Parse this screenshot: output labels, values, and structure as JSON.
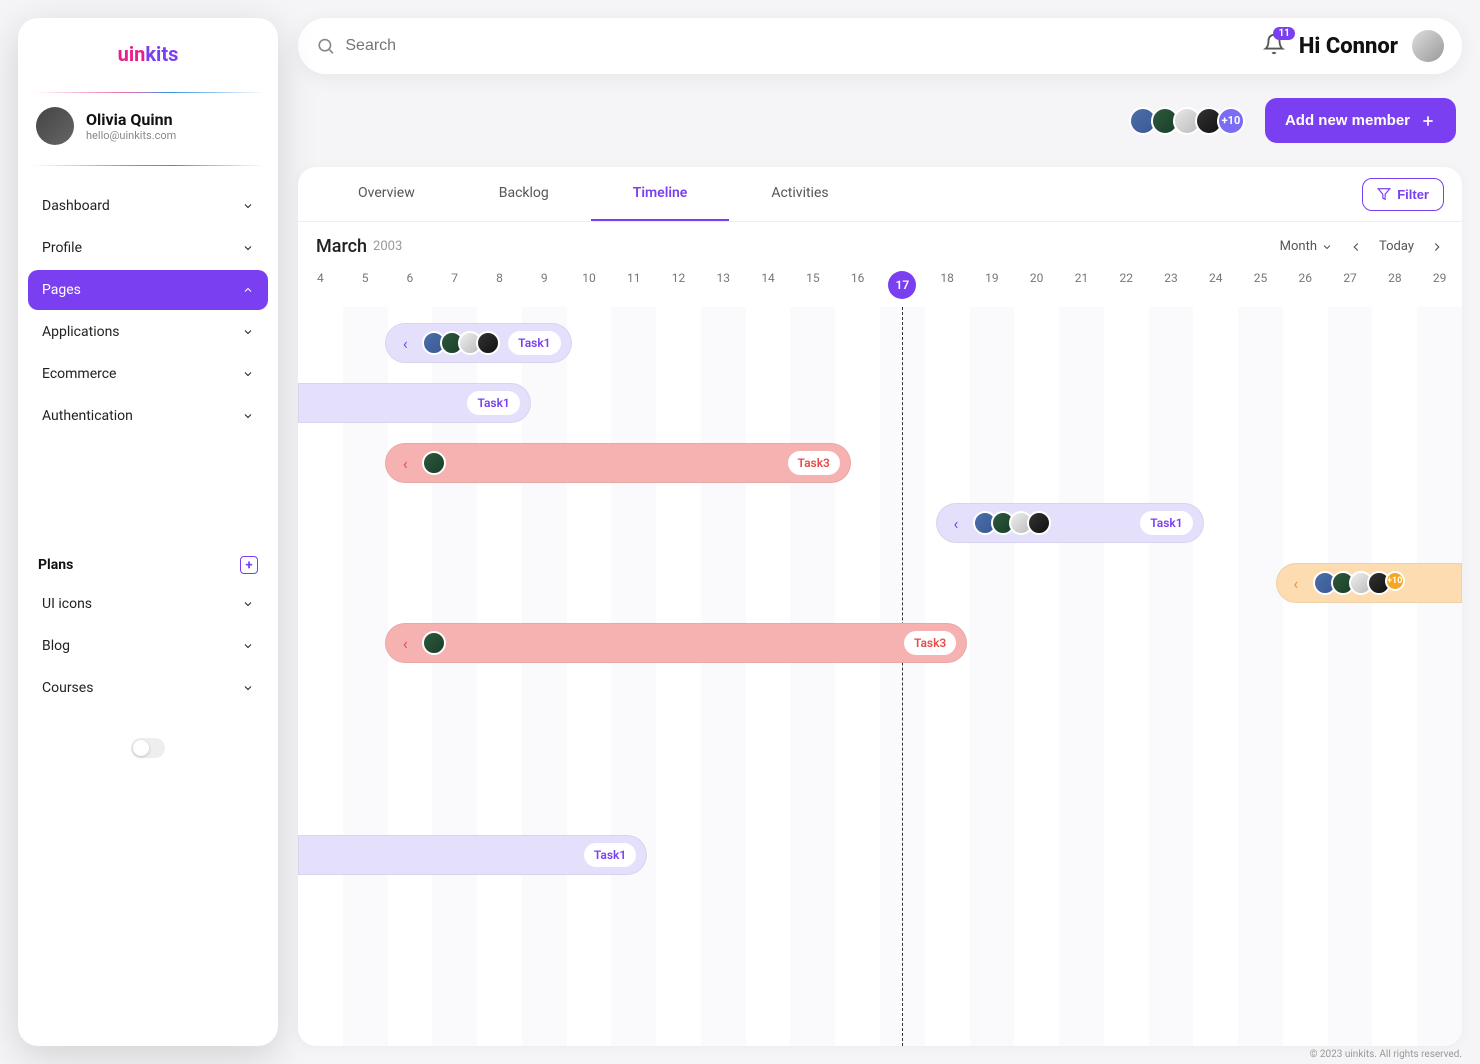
{
  "brand": {
    "part1": "uin",
    "part2": "kits"
  },
  "user": {
    "name": "Olivia Quinn",
    "email": "hello@uinkits.com"
  },
  "nav": {
    "items": [
      {
        "label": "Dashboard"
      },
      {
        "label": "Profile"
      },
      {
        "label": "Pages"
      },
      {
        "label": "Applications"
      },
      {
        "label": "Ecommerce"
      },
      {
        "label": "Authentication"
      }
    ]
  },
  "plans": {
    "title": "Plans",
    "items": [
      {
        "label": "UI icons"
      },
      {
        "label": "Blog"
      },
      {
        "label": "Courses"
      }
    ]
  },
  "search": {
    "placeholder": "Search"
  },
  "notifications": {
    "count": "11"
  },
  "greeting": "Hi Connor",
  "members": {
    "more": "+10",
    "add_label": "Add new member"
  },
  "tabs": {
    "overview": "Overview",
    "backlog": "Backlog",
    "timeline": "Timeline",
    "activities": "Activities"
  },
  "filter_label": "Filter",
  "timeline": {
    "month": "March",
    "year": "2003",
    "view_label": "Month",
    "today_label": "Today",
    "today_day": "17",
    "days": [
      "4",
      "5",
      "6",
      "7",
      "8",
      "9",
      "10",
      "11",
      "12",
      "13",
      "14",
      "15",
      "16",
      "17",
      "18",
      "19",
      "20",
      "21",
      "22",
      "23",
      "24",
      "25",
      "26",
      "27",
      "28",
      "29"
    ]
  },
  "tasks": {
    "t1": "Task1",
    "t3": "Task3",
    "more": "+10"
  },
  "footer": "© 2023 uinkits. All rights reserved."
}
